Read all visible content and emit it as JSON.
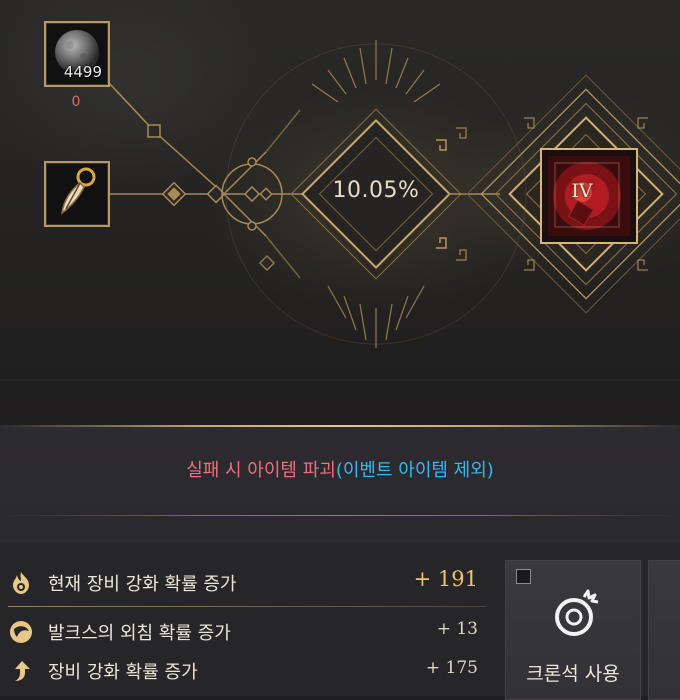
{
  "materials": [
    {
      "icon": "moon-stone-icon",
      "count": "4499",
      "qty": "0"
    },
    {
      "icon": "talon-pendant-icon"
    }
  ],
  "success_rate": "10.05%",
  "target_item": {
    "tier": "IV",
    "icon": "red-gem-accessory-icon"
  },
  "warning": {
    "main": "실패 시 아이템 파괴",
    "note": "(이벤트 아이템 제외)"
  },
  "stats": [
    {
      "icon": "flame-icon",
      "label": "현재 장비 강화 확률 증가",
      "value": "+ 191"
    },
    {
      "icon": "valkus-orb-icon",
      "label": "발크스의 외침 확률 증가",
      "value": "+ 13"
    },
    {
      "icon": "arrow-up-icon",
      "label": "장비 강화 확률 증가",
      "value": "+ 175"
    }
  ],
  "action": {
    "label": "크론석 사용",
    "icon": "cron-stone-icon",
    "checked": false
  },
  "colors": {
    "gold": "#c9a96a",
    "warning_red": "#f06d82",
    "note_blue": "#37b7ef",
    "highlight": "#f0c46a"
  }
}
